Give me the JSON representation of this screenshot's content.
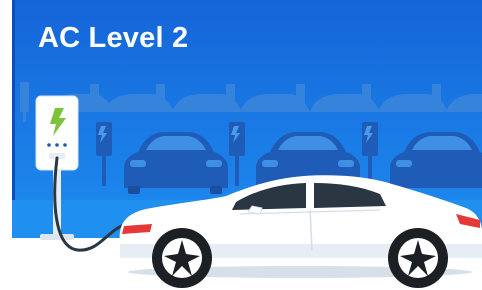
{
  "card": {
    "title": "AC Level 2"
  },
  "colors": {
    "sky_top": "#1565d8",
    "sky_bottom": "#1f8ff0",
    "silhouette_far": "#3b86d9",
    "silhouette_near": "#1e5cb8",
    "car_body": "#ffffff",
    "car_window": "#2a3642",
    "lightning": "#7dc33a"
  },
  "icons": {
    "charger": "ev-charger-icon",
    "lightning": "lightning-bolt-icon"
  }
}
